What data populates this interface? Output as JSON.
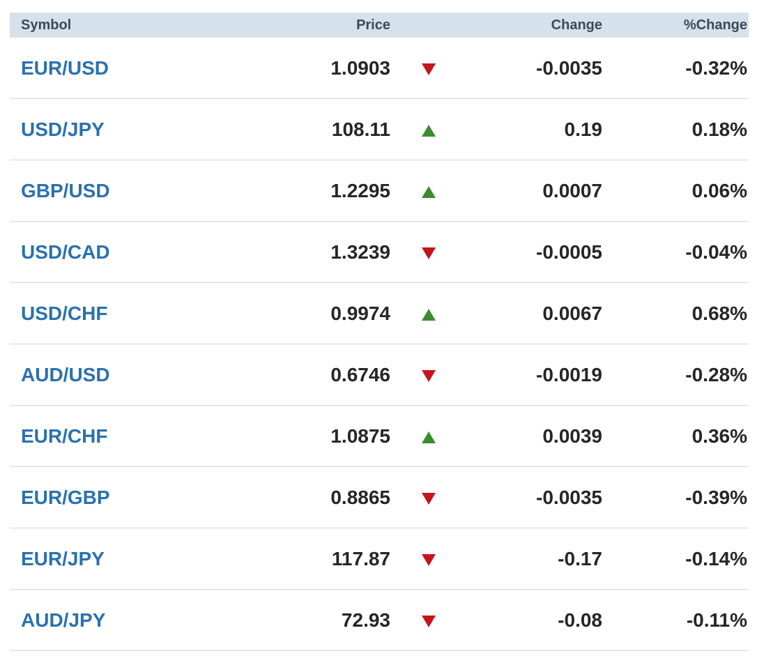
{
  "table": {
    "headers": {
      "symbol": "Symbol",
      "price": "Price",
      "change": "Change",
      "pct_change": "%Change"
    },
    "colors": {
      "symbol_link": "#2a71b0",
      "up": "#3a8c2c",
      "down": "#c4151c",
      "header_bg": "#d6e2eb"
    },
    "rows": [
      {
        "symbol": "EUR/USD",
        "price": "1.0903",
        "direction": "down",
        "direction_icon": "arrow-down-icon",
        "change": "-0.0035",
        "pct_change": "-0.32%"
      },
      {
        "symbol": "USD/JPY",
        "price": "108.11",
        "direction": "up",
        "direction_icon": "arrow-up-icon",
        "change": "0.19",
        "pct_change": "0.18%"
      },
      {
        "symbol": "GBP/USD",
        "price": "1.2295",
        "direction": "up",
        "direction_icon": "arrow-up-icon",
        "change": "0.0007",
        "pct_change": "0.06%"
      },
      {
        "symbol": "USD/CAD",
        "price": "1.3239",
        "direction": "down",
        "direction_icon": "arrow-down-icon",
        "change": "-0.0005",
        "pct_change": "-0.04%"
      },
      {
        "symbol": "USD/CHF",
        "price": "0.9974",
        "direction": "up",
        "direction_icon": "arrow-up-icon",
        "change": "0.0067",
        "pct_change": "0.68%"
      },
      {
        "symbol": "AUD/USD",
        "price": "0.6746",
        "direction": "down",
        "direction_icon": "arrow-down-icon",
        "change": "-0.0019",
        "pct_change": "-0.28%"
      },
      {
        "symbol": "EUR/CHF",
        "price": "1.0875",
        "direction": "up",
        "direction_icon": "arrow-up-icon",
        "change": "0.0039",
        "pct_change": "0.36%"
      },
      {
        "symbol": "EUR/GBP",
        "price": "0.8865",
        "direction": "down",
        "direction_icon": "arrow-down-icon",
        "change": "-0.0035",
        "pct_change": "-0.39%"
      },
      {
        "symbol": "EUR/JPY",
        "price": "117.87",
        "direction": "down",
        "direction_icon": "arrow-down-icon",
        "change": "-0.17",
        "pct_change": "-0.14%"
      },
      {
        "symbol": "AUD/JPY",
        "price": "72.93",
        "direction": "down",
        "direction_icon": "arrow-down-icon",
        "change": "-0.08",
        "pct_change": "-0.11%"
      }
    ]
  }
}
